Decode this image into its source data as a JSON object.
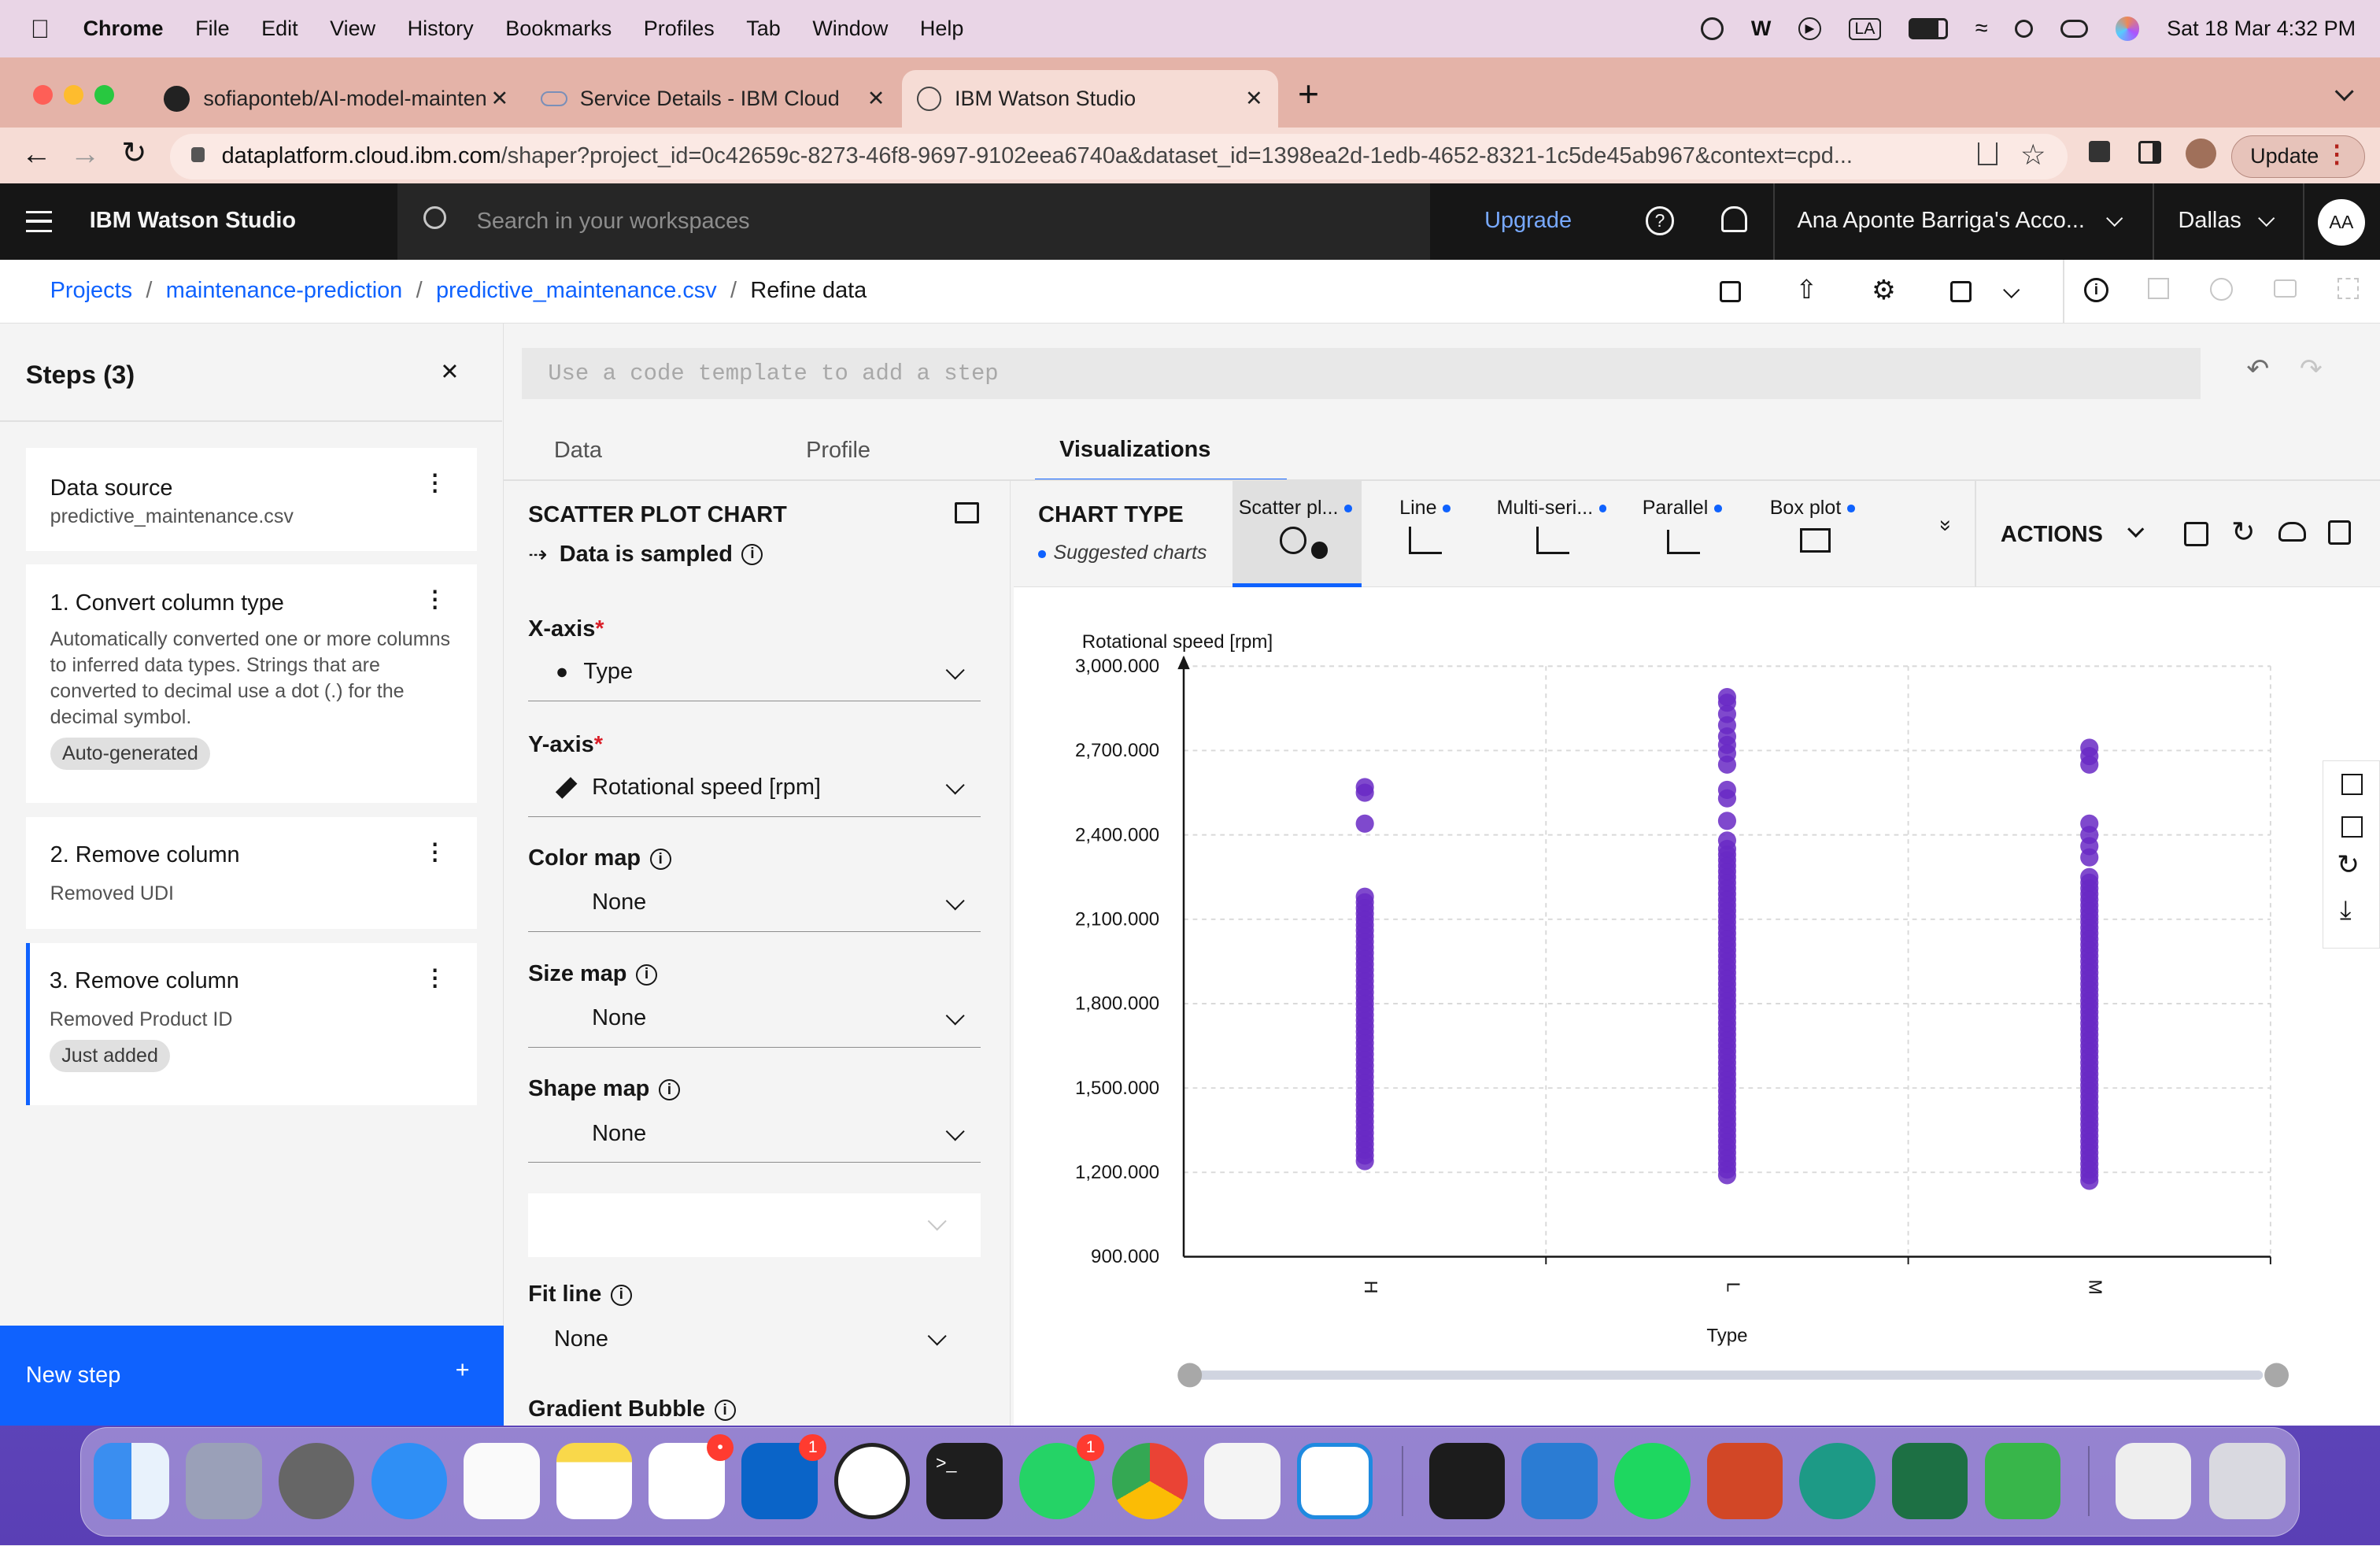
{
  "menubar": {
    "app": "Chrome",
    "items": [
      "File",
      "Edit",
      "View",
      "History",
      "Bookmarks",
      "Profiles",
      "Tab",
      "Window",
      "Help"
    ],
    "status_tag": "LA",
    "datetime": "Sat 18 Mar  4:32 PM"
  },
  "browser": {
    "tabs": [
      {
        "title": "sofiaponteb/AI-model-mainten"
      },
      {
        "title": "Service Details - IBM Cloud"
      },
      {
        "title": "IBM Watson Studio"
      }
    ],
    "url_domain": "dataplatform.cloud.ibm.com",
    "url_path": "/shaper?project_id=0c42659c-8273-46f8-9697-9102eea6740a&dataset_id=1398ea2d-1edb-4652-8321-1c5de45ab967&context=cpd...",
    "update_label": "Update"
  },
  "header": {
    "product": "IBM Watson Studio",
    "search_placeholder": "Search in your workspaces",
    "upgrade": "Upgrade",
    "account": "Ana Aponte Barriga's Acco...",
    "region": "Dallas",
    "avatar": "AA"
  },
  "breadcrumb": {
    "items": [
      "Projects",
      "maintenance-prediction",
      "predictive_maintenance.csv"
    ],
    "current": "Refine data"
  },
  "steps": {
    "title": "Steps (3)",
    "source_title": "Data source",
    "source_file": "predictive_maintenance.csv",
    "step1_title": "1. Convert column type",
    "step1_desc": "Automatically converted one or more columns to inferred data types. Strings that are converted to decimal use a dot (.) for the decimal symbol.",
    "step1_tag": "Auto-generated",
    "step2_title": "2. Remove column",
    "step2_desc": "Removed UDI",
    "step3_title": "3. Remove column",
    "step3_desc": "Removed Product ID",
    "step3_tag": "Just added",
    "new_step": "New step"
  },
  "editor": {
    "code_placeholder": "Use a code template to add a step",
    "tabs": [
      "Data",
      "Profile",
      "Visualizations"
    ],
    "active_tab": "Visualizations"
  },
  "config": {
    "title": "SCATTER PLOT CHART",
    "sampled": "Data is sampled",
    "xaxis_label": "X-axis",
    "xaxis_value": "Type",
    "yaxis_label": "Y-axis",
    "yaxis_value": "Rotational speed [rpm]",
    "colormap_label": "Color map",
    "colormap_value": "None",
    "sizemap_label": "Size map",
    "sizemap_value": "None",
    "shapemap_label": "Shape map",
    "shapemap_value": "None",
    "fitline_label": "Fit line",
    "fitline_value": "None",
    "gradient_label": "Gradient Bubble"
  },
  "charttype": {
    "title": "CHART TYPE",
    "suggested": "Suggested charts",
    "types": [
      "Scatter pl...",
      "Line",
      "Multi-seri...",
      "Parallel",
      "Box plot"
    ],
    "actions": "ACTIONS"
  },
  "chart_data": {
    "type": "scatter",
    "title": "",
    "xlabel": "Type",
    "ylabel": "Rotational speed [rpm]",
    "categories": [
      "H",
      "L",
      "M"
    ],
    "ylim": [
      900,
      3000
    ],
    "yticks": [
      "3,000.000",
      "2,700.000",
      "2,400.000",
      "2,100.000",
      "1,800.000",
      "1,500.000",
      "1,200.000",
      "900.000"
    ],
    "color": "#6929c4",
    "grid": true,
    "series": [
      {
        "category": "H",
        "range": [
          1240,
          2180
        ],
        "outliers": [
          2440,
          2550,
          2570
        ]
      },
      {
        "category": "L",
        "range": [
          1190,
          2350
        ],
        "outliers": [
          2380,
          2450,
          2530,
          2560,
          2650,
          2690,
          2720,
          2750,
          2790,
          2830,
          2870,
          2890
        ]
      },
      {
        "category": "M",
        "range": [
          1170,
          2260
        ],
        "outliers": [
          2320,
          2360,
          2400,
          2440,
          2650,
          2680,
          2710
        ]
      }
    ]
  }
}
